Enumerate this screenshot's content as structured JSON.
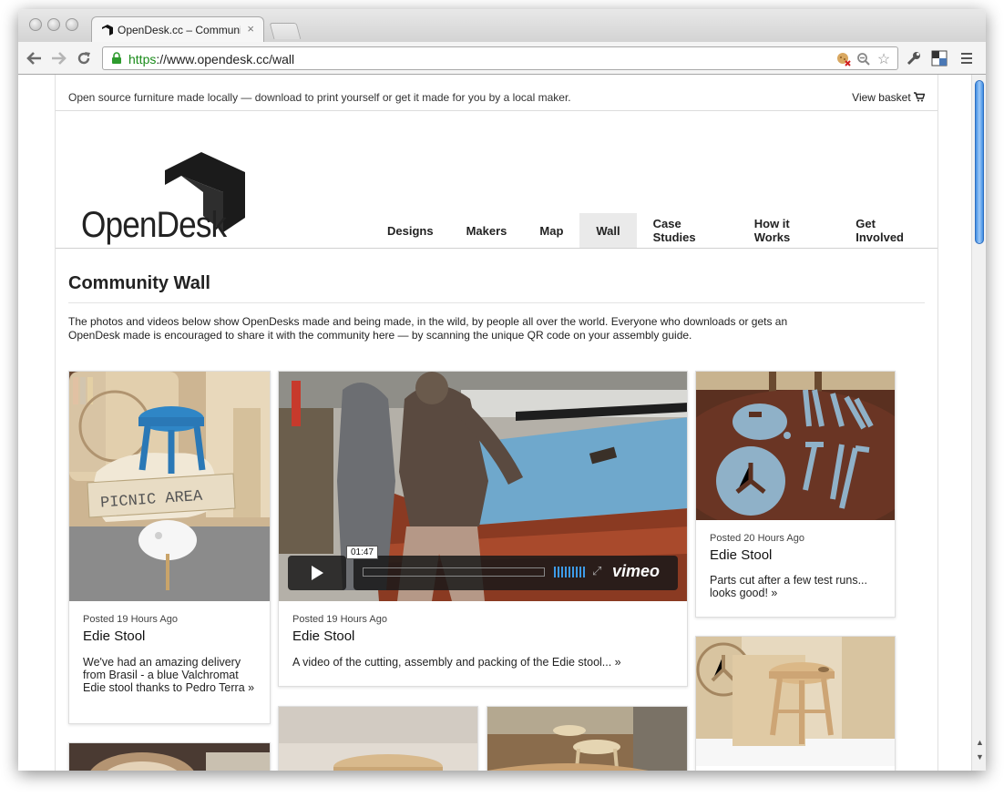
{
  "browser": {
    "tab_title": "OpenDesk.cc – Community",
    "tab_close": "×",
    "url_scheme": "https",
    "url_rest": "://www.opendesk.cc/wall"
  },
  "site": {
    "tagline": "Open source furniture made locally — download to print yourself or get it made for you by a local maker.",
    "basket_label": "View basket",
    "logo_text": "OpenDesk",
    "nav": [
      "Designs",
      "Makers",
      "Map",
      "Wall",
      "Case Studies",
      "How it Works",
      "Get Involved"
    ],
    "active_nav": "Wall"
  },
  "page": {
    "title": "Community Wall",
    "intro": "The photos and videos below show OpenDesks made and being made, in the wild, by people all over the world. Everyone who downloads or gets an OpenDesk made is encouraged to share it with the community here — by scanning the unique QR code on your assembly guide."
  },
  "posts": [
    {
      "posted": "Posted 19 Hours Ago",
      "title": "Edie Stool",
      "body": "We've had an amazing delivery from Brasil - a blue Valchromat Edie stool thanks to Pedro Terra »",
      "image_text": "PICNIC AREA"
    },
    {
      "posted": "Posted 19 Hours Ago",
      "title": "Edie Stool",
      "body": "A video of the cutting, assembly and packing of the Edie stool... »",
      "video_time": "01:47",
      "video_brand": "vimeo"
    },
    {
      "posted": "Posted 20 Hours Ago",
      "title": "Edie Stool",
      "body": "Parts cut after a few test runs... looks good! »"
    }
  ],
  "icons": {
    "back": "back-arrow-icon",
    "forward": "forward-arrow-icon",
    "reload": "reload-icon",
    "lock": "lock-icon",
    "star": "star-icon",
    "wrench": "wrench-icon",
    "cart": "cart-icon"
  },
  "colors": {
    "secure_green": "#1a8b1a",
    "video_bg": "#6fa8cc",
    "active_nav_bg": "#eaeaea"
  }
}
